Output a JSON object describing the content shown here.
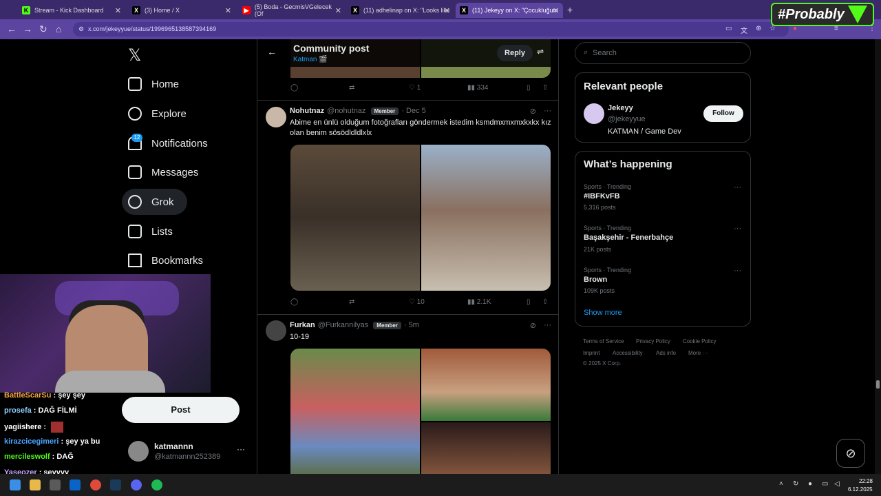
{
  "browser": {
    "tabs": [
      {
        "title": "Stream - Kick Dashboard",
        "favicon": "K",
        "color": "#53fc18"
      },
      {
        "title": "(3) Home / X",
        "favicon": "X",
        "color": "#000000"
      },
      {
        "title": "(5) Boda - GecmisVGelecek (Of",
        "favicon": "▶",
        "color": "#ff0000"
      },
      {
        "title": "(11) adhelinap on X: \"Looks like",
        "favicon": "X",
        "color": "#000000"
      },
      {
        "title": "(11) Jekeyy on X: \"Çocukluğunu",
        "favicon": "X",
        "color": "#000000"
      }
    ],
    "url": "x.com/jekeyyue/status/1996965138587394169",
    "new_tab": "+"
  },
  "overlay": {
    "brand": "#Probably"
  },
  "nav": {
    "logo": "𝕏",
    "items": [
      {
        "label": "Home",
        "icon": "home-icon"
      },
      {
        "label": "Explore",
        "icon": "search-icon"
      },
      {
        "label": "Notifications",
        "icon": "bell-icon"
      },
      {
        "label": "Messages",
        "icon": "mail-icon"
      },
      {
        "label": "Grok",
        "icon": "grok-icon"
      },
      {
        "label": "Lists",
        "icon": "list-icon"
      },
      {
        "label": "Bookmarks",
        "icon": "bookmark-icon"
      }
    ],
    "notif_badge": "12",
    "post_button": "Post",
    "account": {
      "name": "katmannn",
      "handle": "@katmannn252389",
      "more": "···"
    }
  },
  "chat": [
    {
      "user": "BattleScarSu",
      "text": ": şey şey",
      "color": "#f4a742"
    },
    {
      "user": "prosefa",
      "text": ": DAĞ FİLMİ",
      "color": "#8fd3ff"
    },
    {
      "user": "yagiishere",
      "text": ":",
      "color": "#ffffff"
    },
    {
      "user": "kirazcicegimeri",
      "text": ": şey ya bu",
      "color": "#4aa3ff"
    },
    {
      "user": "mercileswolf",
      "text": ": DAĞ",
      "color": "#53fc18"
    },
    {
      "user": "Yaseozer",
      "text": ": şeyyyy",
      "color": "#c9a8ff"
    }
  ],
  "header": {
    "title": "Community post",
    "community": "Katman 🎬",
    "reply": "Reply"
  },
  "posts": [
    {
      "counts": {
        "reply": "",
        "repost": "",
        "like": "1",
        "views": "334"
      }
    },
    {
      "name": "Nohutnaz",
      "handle": "@nohutnaz",
      "badge": "Member",
      "time": "· Dec 5",
      "text": "Abime en ünlü olduğum fotoğrafları göndermek istedim ksmdmxmxmxkxkx kız olan benim sösödldldlxlx",
      "counts": {
        "reply": "",
        "repost": "",
        "like": "10",
        "views": "2.1K"
      }
    },
    {
      "name": "Furkan",
      "handle": "@Furkannilyas",
      "badge": "Member",
      "time": "· 5m",
      "text": "10-19"
    }
  ],
  "right": {
    "search_placeholder": "Search",
    "relevant": {
      "title": "Relevant people",
      "name": "Jekeyy",
      "handle": "@jekeyyue",
      "bio": "KATMAN / Game Dev",
      "follow": "Follow"
    },
    "happening": {
      "title": "What’s happening",
      "trends": [
        {
          "category": "Sports · Trending",
          "name": "#IBFKvFB",
          "count": "5,316 posts"
        },
        {
          "category": "Sports · Trending",
          "name": "Başakşehir - Fenerbahçe",
          "count": "21K posts"
        },
        {
          "category": "Sports · Trending",
          "name": "Brown",
          "count": "109K posts"
        }
      ],
      "show_more": "Show more"
    },
    "footer": {
      "terms": "Terms of Service",
      "privacy": "Privacy Policy",
      "cookie": "Cookie Policy",
      "imprint": "Imprint",
      "accessibility": "Accessibility",
      "ads": "Ads info",
      "more": "More ···",
      "copyright": "© 2025 X Corp."
    }
  },
  "taskbar": {
    "time": "22:28",
    "date": "6.12.2025"
  }
}
